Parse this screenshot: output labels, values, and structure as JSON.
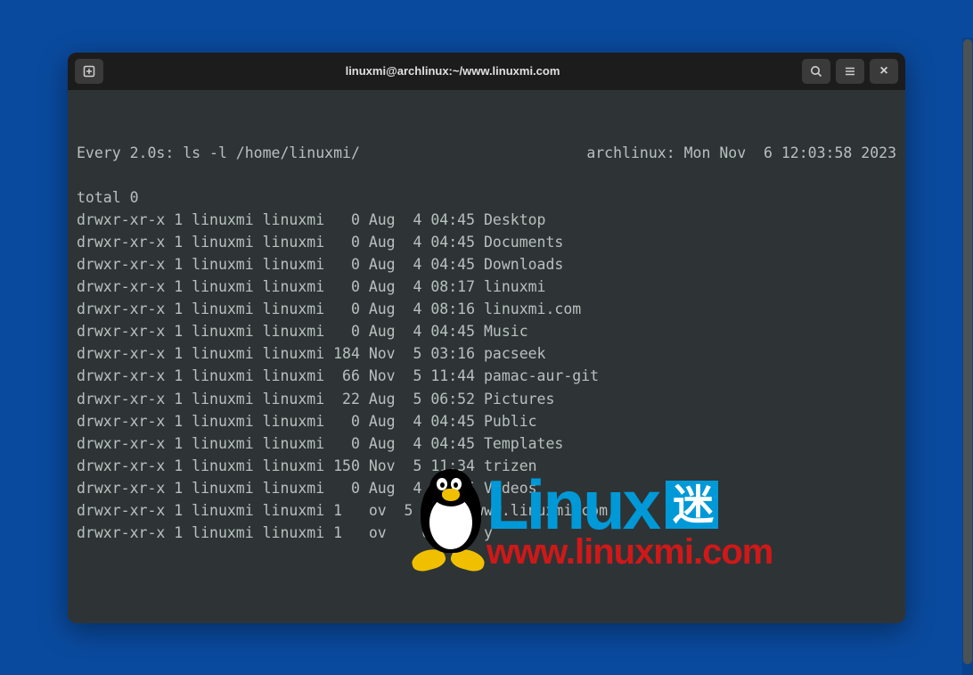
{
  "window": {
    "title": "linuxmi@archlinux:~/www.linuxmi.com"
  },
  "watch": {
    "left": "Every 2.0s: ls -l /home/linuxmi/",
    "right": "archlinux: Mon Nov  6 12:03:58 2023"
  },
  "listing": {
    "total": "total 0",
    "rows": [
      "drwxr-xr-x 1 linuxmi linuxmi   0 Aug  4 04:45 Desktop",
      "drwxr-xr-x 1 linuxmi linuxmi   0 Aug  4 04:45 Documents",
      "drwxr-xr-x 1 linuxmi linuxmi   0 Aug  4 04:45 Downloads",
      "drwxr-xr-x 1 linuxmi linuxmi   0 Aug  4 08:17 linuxmi",
      "drwxr-xr-x 1 linuxmi linuxmi   0 Aug  4 08:16 linuxmi.com",
      "drwxr-xr-x 1 linuxmi linuxmi   0 Aug  4 04:45 Music",
      "drwxr-xr-x 1 linuxmi linuxmi 184 Nov  5 03:16 pacseek",
      "drwxr-xr-x 1 linuxmi linuxmi  66 Nov  5 11:44 pamac-aur-git",
      "drwxr-xr-x 1 linuxmi linuxmi  22 Aug  5 06:52 Pictures",
      "drwxr-xr-x 1 linuxmi linuxmi   0 Aug  4 04:45 Public",
      "drwxr-xr-x 1 linuxmi linuxmi   0 Aug  4 04:45 Templates",
      "drwxr-xr-x 1 linuxmi linuxmi 150 Nov  5 11:34 trizen",
      "drwxr-xr-x 1 linuxmi linuxmi   0 Aug  4 04:45 Videos",
      "drwxr-xr-x 1 linuxmi linuxmi 1   ov  5 11:26 www.linuxmi.com",
      "drwxr-xr-x 1 linuxmi linuxmi 1   ov    02:0   y"
    ]
  },
  "watermark": {
    "brand": "Linux",
    "suffix": "迷",
    "url": "www.linuxmi.com"
  }
}
